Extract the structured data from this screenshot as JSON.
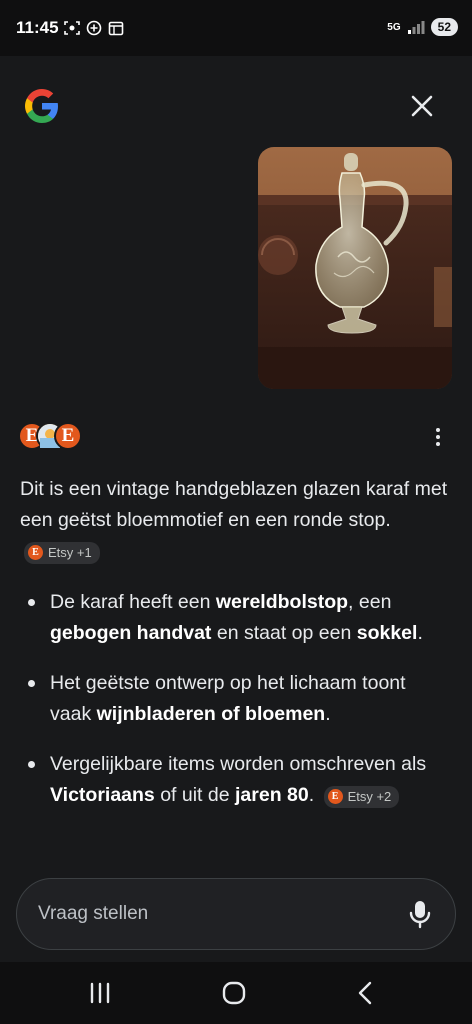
{
  "status_bar": {
    "time": "11:45",
    "network": "5G",
    "battery": "52",
    "left_icons": [
      "screenshot-icon",
      "gamepad-icon",
      "calendar-icon"
    ],
    "right_icons": [
      "signal-icon",
      "battery-icon"
    ]
  },
  "header": {
    "logo_icon": "google-g-icon",
    "close_icon": "close-icon"
  },
  "query_image": {
    "description_icon": "query-photo"
  },
  "sources": {
    "letters": [
      "E",
      "E"
    ],
    "more_icon": "more-vert-icon"
  },
  "answer": {
    "intro": "Dit is een vintage handgeblazen glazen karaf met een geëtst bloemmotief en een ronde stop.",
    "intro_chip": {
      "label": "Etsy +1",
      "icon_letter": "E"
    },
    "bullets": [
      {
        "pre": "De karaf heeft een ",
        "b1": "wereldbolstop",
        "mid1": ", een ",
        "b2": "gebogen handvat",
        "mid2": " en staat op een ",
        "b3": "sokkel",
        "post": "."
      },
      {
        "pre": "Het geëtste ontwerp op het lichaam toont vaak ",
        "b1": "wijnbladeren of bloemen",
        "post": "."
      },
      {
        "pre": "Vergelijkbare items worden omschreven als ",
        "b1": "Victoriaans",
        "mid1": " of uit de ",
        "b2": "jaren 80",
        "post": ".",
        "chip": {
          "label": "Etsy +2",
          "icon_letter": "E"
        }
      }
    ]
  },
  "ask_bar": {
    "placeholder": "Vraag stellen",
    "mic_icon": "mic-icon"
  },
  "nav_bar": {
    "icons": [
      "recent-apps-icon",
      "home-icon",
      "back-icon"
    ]
  },
  "colors": {
    "background": "#18191b",
    "text": "#e8eaed",
    "chip_bg": "#303134",
    "etsy_orange": "#e2581d"
  }
}
